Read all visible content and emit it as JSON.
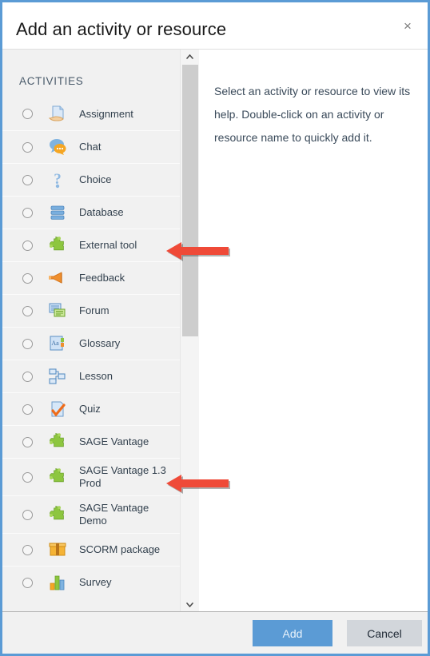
{
  "window": {
    "title": "Add an activity or resource",
    "close_label": "×",
    "border_color": "#5b9bd5"
  },
  "left_panel": {
    "section_header": "ACTIVITIES",
    "items": [
      {
        "label": "Assignment",
        "icon": "assignment-hand-document-icon",
        "selected": false
      },
      {
        "label": "Chat",
        "icon": "chat-speech-bubbles-icon",
        "selected": false
      },
      {
        "label": "Choice",
        "icon": "question-mark-icon",
        "selected": false
      },
      {
        "label": "Database",
        "icon": "database-stack-icon",
        "selected": false
      },
      {
        "label": "External tool",
        "icon": "green-puzzle-piece-icon",
        "selected": false
      },
      {
        "label": "Feedback",
        "icon": "megaphone-icon",
        "selected": false
      },
      {
        "label": "Forum",
        "icon": "forum-discussion-icon",
        "selected": false
      },
      {
        "label": "Glossary",
        "icon": "glossary-book-aa-icon",
        "selected": false
      },
      {
        "label": "Lesson",
        "icon": "lesson-flowchart-icon",
        "selected": false
      },
      {
        "label": "Quiz",
        "icon": "quiz-checkmark-page-icon",
        "selected": false
      },
      {
        "label": "SAGE Vantage",
        "icon": "green-puzzle-piece-icon",
        "selected": false
      },
      {
        "label": "SAGE Vantage 1.3 Prod",
        "icon": "green-puzzle-piece-icon",
        "selected": false
      },
      {
        "label": "SAGE Vantage Demo",
        "icon": "green-puzzle-piece-icon",
        "selected": false
      },
      {
        "label": "SCORM package",
        "icon": "scorm-box-package-icon",
        "selected": false
      },
      {
        "label": "Survey",
        "icon": "survey-bar-chart-icon",
        "selected": false
      }
    ]
  },
  "scrollbar": {
    "up_arrow": "chevron-up-icon",
    "down_arrow": "chevron-down-icon"
  },
  "right_panel": {
    "help_text": "Select an activity or resource to view its help. Double-click on an activity or resource name to quickly add it."
  },
  "footer": {
    "add_label": "Add",
    "cancel_label": "Cancel",
    "add_color": "#5b9bd5",
    "cancel_color": "#d2d6db"
  },
  "annotations": {
    "color": "#ef4a38",
    "arrows": [
      {
        "name": "arrow-pointing-to-external-tool",
        "target": "External tool"
      },
      {
        "name": "arrow-pointing-to-sage-vantage-13-prod",
        "target": "SAGE Vantage 1.3 Prod"
      }
    ]
  }
}
